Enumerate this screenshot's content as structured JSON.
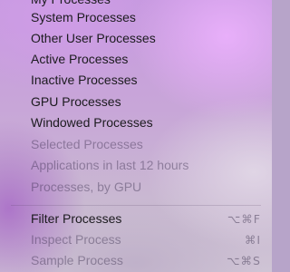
{
  "menu": {
    "groups": [
      {
        "items": [
          {
            "label": "My Processes",
            "enabled": true
          },
          {
            "label": "System Processes",
            "enabled": true
          },
          {
            "label": "Other User Processes",
            "enabled": true
          },
          {
            "label": "Active Processes",
            "enabled": true
          },
          {
            "label": "Inactive Processes",
            "enabled": true
          },
          {
            "label": "GPU Processes",
            "enabled": true
          },
          {
            "label": "Windowed Processes",
            "enabled": true
          },
          {
            "label": "Selected Processes",
            "enabled": false
          },
          {
            "label": "Applications in last 12 hours",
            "enabled": false
          },
          {
            "label": "Processes, by GPU",
            "enabled": false
          }
        ]
      },
      {
        "items": [
          {
            "label": "Filter Processes",
            "enabled": true,
            "shortcut": "⌥⌘F"
          },
          {
            "label": "Inspect Process",
            "enabled": false,
            "shortcut": "⌘I"
          },
          {
            "label": "Sample Process",
            "enabled": false,
            "shortcut": "⌥⌘S"
          }
        ]
      }
    ]
  }
}
